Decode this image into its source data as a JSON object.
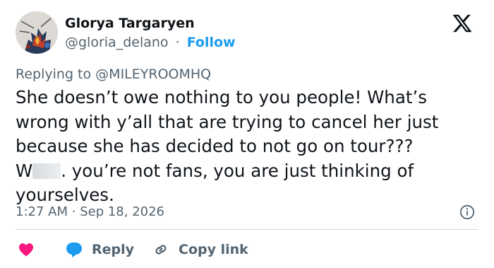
{
  "author": {
    "display_name": "Glorya Targaryen",
    "handle": "@gloria_delano",
    "separator": "·",
    "follow_label": "Follow"
  },
  "reply_context": {
    "prefix": "Replying to",
    "mention": "@MILEYROOMHQ"
  },
  "tweet": {
    "lines": [
      "She doesn’t owe nothing to you people! What’s",
      "wrong with y’all that are trying to cancel her just",
      "because she has decided to not go on tour???"
    ],
    "line4_start": "W",
    "line4_end": ". you’re not fans, you are just thinking of",
    "line5": "yourselves."
  },
  "timestamp": {
    "time": "1:27 AM",
    "separator": "·",
    "date": "Sep 18, 2026"
  },
  "actions": {
    "reply_label": "Reply",
    "copy_link_label": "Copy link"
  },
  "icons": {
    "brand": "x-logo-icon",
    "info": "info-icon",
    "like": "heart-icon",
    "reply": "speech-bubble-icon",
    "copy": "link-icon"
  },
  "colors": {
    "follow": "#1d9bf0",
    "heart": "#f91880",
    "reply_bubble": "#1d9bf0",
    "secondary_text": "#536471",
    "primary_text": "#0f1419",
    "divider": "#cfd9de"
  }
}
